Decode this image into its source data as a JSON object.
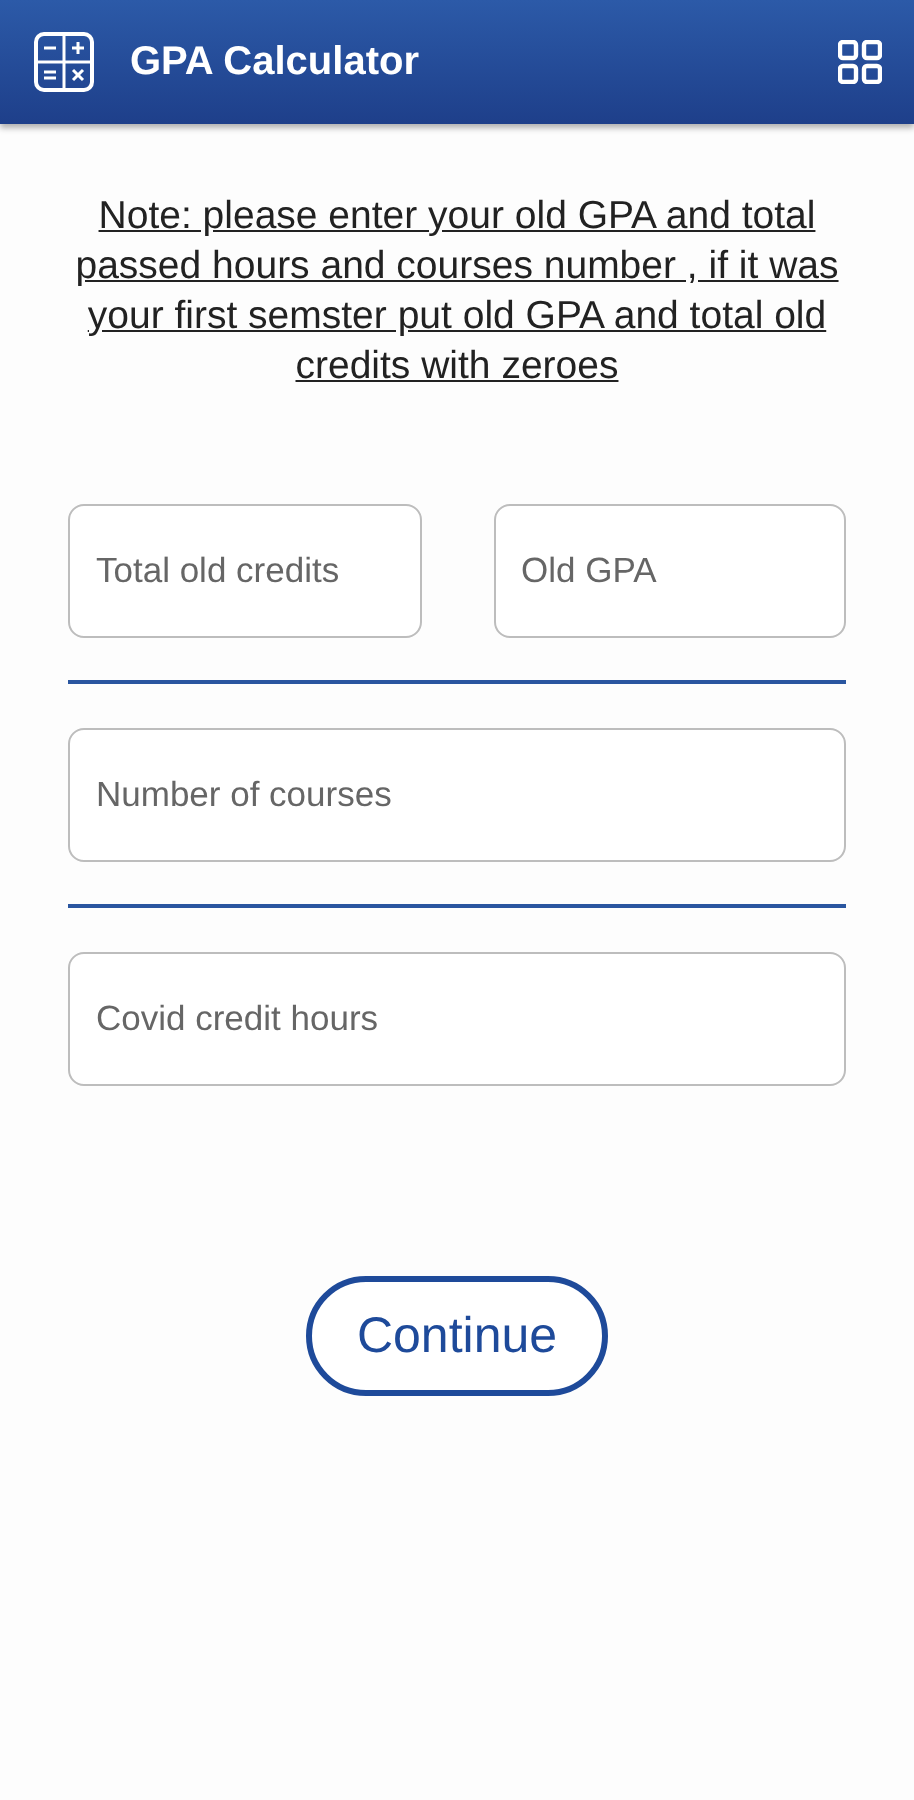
{
  "app_bar": {
    "title": "GPA Calculator"
  },
  "note": "Note: please enter your old GPA and total passed hours and courses number , if it was your first semster put old GPA and total old credits with zeroes",
  "field_rows": [
    {
      "fields": [
        {
          "placeholder": "Total old credits"
        },
        {
          "placeholder": "Old GPA"
        }
      ]
    },
    {
      "fields": [
        {
          "placeholder": "Number of courses"
        }
      ]
    },
    {
      "fields": [
        {
          "placeholder": "Covid credit hours"
        }
      ]
    }
  ],
  "continue_button": "Continue"
}
